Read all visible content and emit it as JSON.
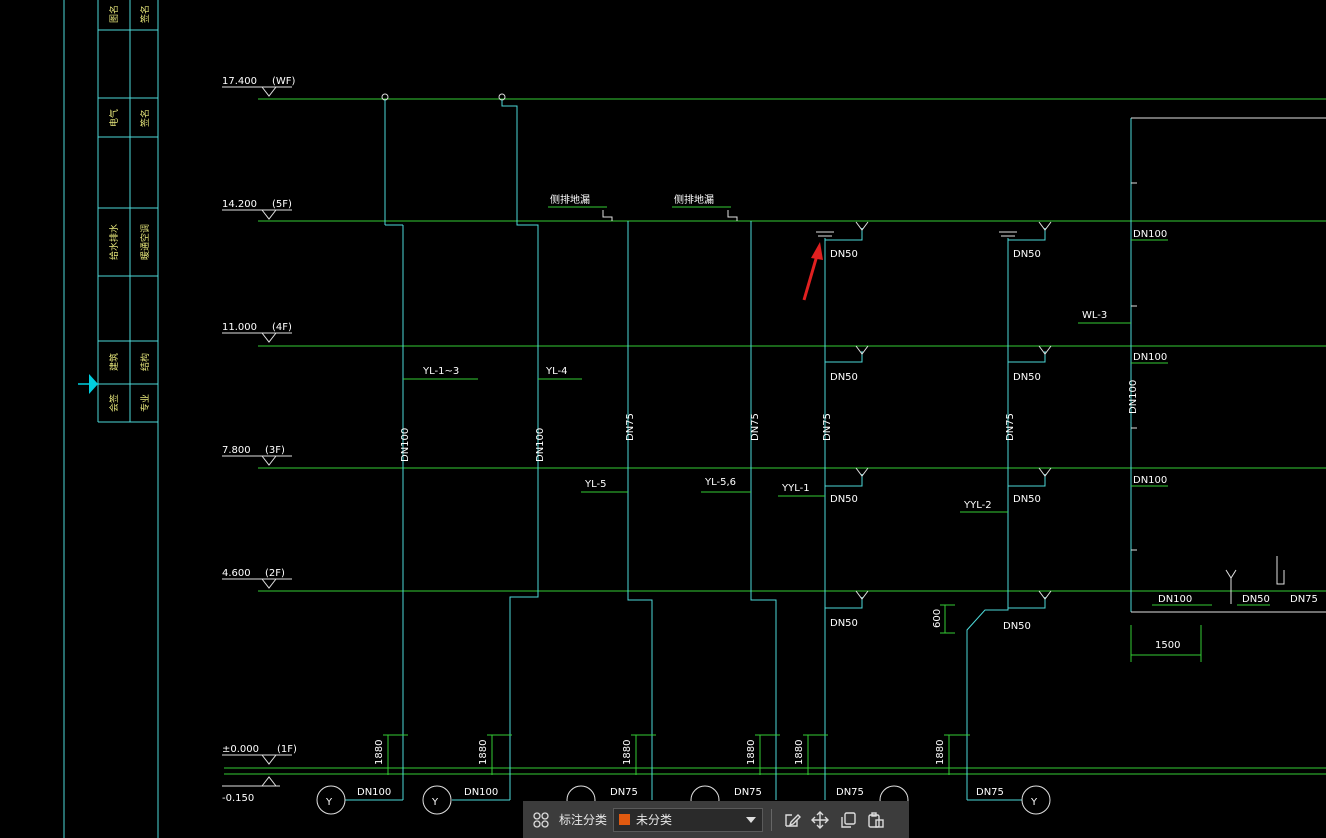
{
  "colors": {
    "background": "#000000",
    "pipe": "#33cc33",
    "dim": "#4dd9d9",
    "marker": "#00cfe0",
    "arrow": "#e02020",
    "swatch": "#e05a10",
    "toolbar": "#3c3c3c"
  },
  "title_block": {
    "row_texts": [
      [
        "图名",
        "签名"
      ],
      [
        "电气",
        "签名"
      ],
      [
        "给水排水",
        "暖通空调"
      ],
      [
        "建筑",
        "结构"
      ],
      [
        "会签",
        "专业"
      ]
    ]
  },
  "levels": [
    {
      "elev": "17.400",
      "floor": "(WF)"
    },
    {
      "elev": "14.200",
      "floor": "(5F)"
    },
    {
      "elev": "11.000",
      "floor": "(4F)"
    },
    {
      "elev": "7.800",
      "floor": "(3F)"
    },
    {
      "elev": "4.600",
      "floor": "(2F)"
    },
    {
      "elev": "±0.000",
      "floor": "(1F)"
    }
  ],
  "bottom_elev": "-0.150",
  "notes": {
    "floor_drain_1": "侧排地漏",
    "floor_drain_2": "侧排地漏"
  },
  "pipe_labels": {
    "yl_1_3": "YL-1~3",
    "yl_4": "YL-4",
    "yl_5": "YL-5",
    "yl_56": "YL-5,6",
    "yyl_1": "YYL-1",
    "yyl_2": "YYL-2",
    "wl_3": "WL-3"
  },
  "sizes": {
    "dn100": "DN100",
    "dn75": "DN75",
    "dn50": "DN50"
  },
  "dims": {
    "d1880": "1880",
    "d600": "600",
    "d1500": "1500"
  },
  "trap_symbol": "Y",
  "toolbar": {
    "label": "标注分类",
    "category": "未分类",
    "icons": [
      "grid-icon",
      "edit-icon",
      "move-icon",
      "copy-icon",
      "paste-icon"
    ]
  }
}
